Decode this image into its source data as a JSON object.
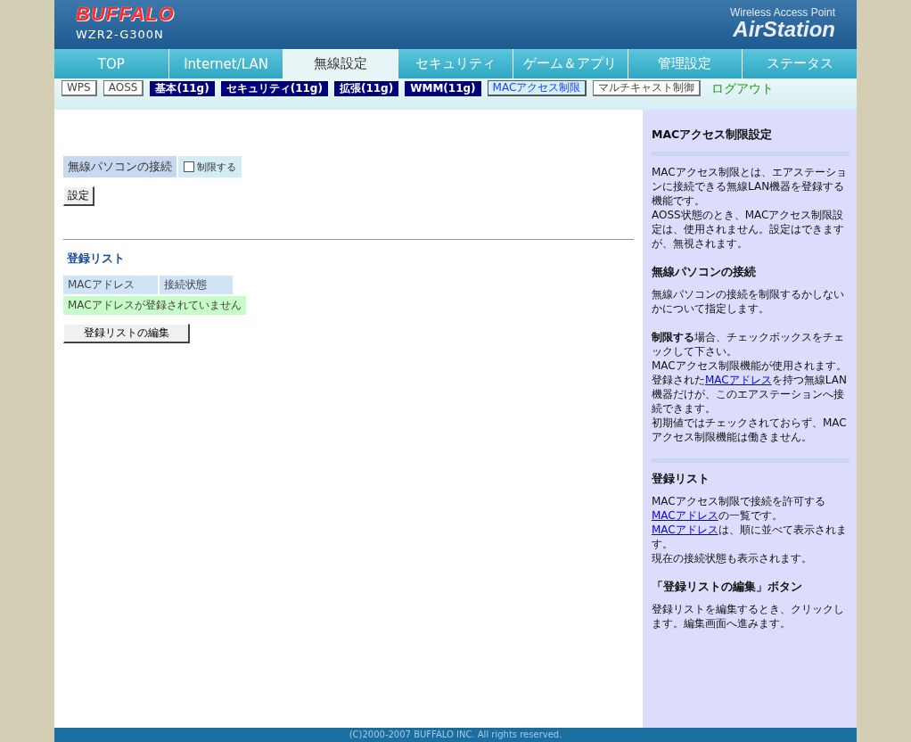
{
  "header": {
    "brand": "BUFFALO",
    "model": "WZR2-G300N",
    "product_line": "Wireless Access Point",
    "product": "AirStation"
  },
  "tabs": [
    {
      "label": "TOP",
      "selected": false
    },
    {
      "label": "Internet/LAN",
      "selected": false
    },
    {
      "label": "無線設定",
      "selected": true
    },
    {
      "label": "セキュリティ",
      "selected": false
    },
    {
      "label": "ゲーム＆アプリ",
      "selected": false
    },
    {
      "label": "管理設定",
      "selected": false
    },
    {
      "label": "ステータス",
      "selected": false
    }
  ],
  "subnav": [
    {
      "label": "WPS",
      "kind": "plain",
      "selected": false
    },
    {
      "label": "AOSS",
      "kind": "plain",
      "selected": false
    },
    {
      "label": "基本(11g)",
      "kind": "navy",
      "selected": false
    },
    {
      "label": "セキュリティ(11g)",
      "kind": "navy",
      "selected": false
    },
    {
      "label": "拡張(11g)",
      "kind": "navy",
      "selected": false
    },
    {
      "label": "WMM(11g)",
      "kind": "navy",
      "selected": false
    },
    {
      "label": "MACアクセス制限",
      "kind": "plain",
      "selected": true
    },
    {
      "label": "マルチキャスト制御",
      "kind": "plain",
      "selected": false
    },
    {
      "label": "ログアウト",
      "kind": "logout",
      "selected": false
    }
  ],
  "setting": {
    "label": "無線パソコンの接続",
    "checkbox_label": "制限する",
    "checked": false,
    "button": "設定"
  },
  "list": {
    "title": "登録リスト",
    "columns": [
      "MACアドレス",
      "接続状態"
    ],
    "empty_message": "MACアドレスが登録されていません",
    "edit_button": "登録リストの編集"
  },
  "help": [
    {
      "kind": "section",
      "title": "MACアクセス制限設定"
    },
    {
      "kind": "divider"
    },
    {
      "kind": "section",
      "blocks": [
        [
          [
            {
              "kind": "text",
              "text": "MACアクセス制限とは、エアステーションに接続できる無線LAN機器を登録する機能です。"
            }
          ],
          [
            {
              "kind": "text",
              "text": "AOSS状態のとき、MACアクセス制限設定は、使用されません。設定はできますが、無視されます。"
            }
          ]
        ]
      ]
    },
    {
      "kind": "section",
      "title": "無線パソコンの接続",
      "blocks": [
        [
          [
            {
              "kind": "text",
              "text": "無線パソコンの接続を制限するかしないかについて指定します。"
            }
          ]
        ],
        [
          [
            {
              "kind": "bold",
              "text": "制限する"
            },
            {
              "kind": "text",
              "text": "場合、チェックボックスをチェックして下さい。"
            }
          ],
          [
            {
              "kind": "text",
              "text": "MACアクセス制限機能が使用されます。"
            }
          ],
          [
            {
              "kind": "text",
              "text": "登録された"
            },
            {
              "kind": "link",
              "text": "MACアドレス"
            },
            {
              "kind": "text",
              "text": "を持つ無線LAN機器だけが、このエアステーションへ接続できます。"
            }
          ],
          [
            {
              "kind": "text",
              "text": "初期値ではチェックされておらず、MACアクセス制限機能は働きません。"
            }
          ]
        ]
      ]
    },
    {
      "kind": "divider"
    },
    {
      "kind": "section",
      "title": "登録リスト",
      "blocks": [
        [
          [
            {
              "kind": "text",
              "text": "MACアクセス制限で接続を許可する"
            }
          ],
          [
            {
              "kind": "link",
              "text": "MACアドレス"
            },
            {
              "kind": "text",
              "text": "の一覧です。"
            }
          ],
          [
            {
              "kind": "link",
              "text": "MACアドレス"
            },
            {
              "kind": "text",
              "text": "は、順に並べて表示されます。"
            }
          ],
          [
            {
              "kind": "text",
              "text": "現在の接続状態も表示されます。"
            }
          ]
        ]
      ]
    },
    {
      "kind": "section",
      "title": "「登録リストの編集」ボタン",
      "blocks": [
        [
          [
            {
              "kind": "text",
              "text": "登録リストを編集するとき、クリックします。編集画面へ進みます。"
            }
          ]
        ]
      ]
    }
  ],
  "footer": "(C)2000-2007 BUFFALO INC. All rights reserved."
}
